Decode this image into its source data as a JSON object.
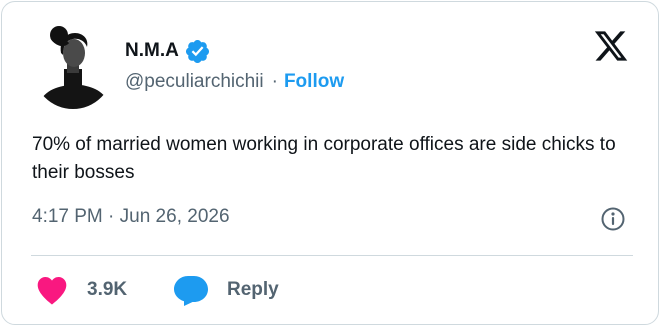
{
  "author": {
    "name": "N.M.A",
    "handle": "@peculiarchichii",
    "separator": "·",
    "follow_label": "Follow"
  },
  "tweet": {
    "text": "70% of married women working in corporate offices are side chicks to their bosses",
    "timestamp": "4:17 PM · Jun 26, 2026"
  },
  "actions": {
    "like_count": "3.9K",
    "reply_label": "Reply"
  },
  "colors": {
    "accent": "#1d9bf0",
    "like": "#f91880",
    "text": "#0f1419",
    "muted": "#536471"
  },
  "icons": [
    "avatar-photo",
    "verified-badge-icon",
    "x-logo-icon",
    "info-icon",
    "heart-icon",
    "reply-bubble-icon"
  ]
}
